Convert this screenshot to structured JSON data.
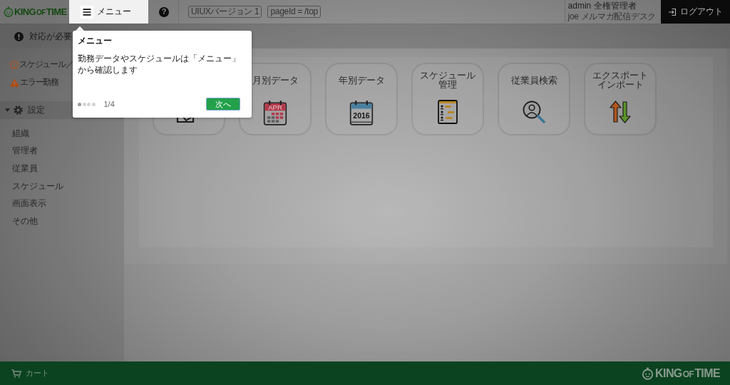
{
  "header": {
    "logo": {
      "words": [
        "KING",
        "OF",
        "TIME"
      ]
    },
    "menu_button": {
      "label": "メニュー"
    },
    "help": "?",
    "badges": [
      "UIUXバージョン 1",
      "pageId = /top"
    ],
    "user": {
      "account": "admin 全権管理者",
      "group": "joe メルマガ配信デスク"
    },
    "logout": "ログアウト"
  },
  "notice": {
    "text": "対応が必要"
  },
  "sidebar": {
    "alerts": [
      {
        "kind": "info",
        "label": "スケジュール／"
      },
      {
        "kind": "warning",
        "label": "エラー勤務"
      }
    ],
    "section": {
      "label": "設定",
      "expanded": true,
      "items": [
        "組織",
        "管理者",
        "従業員",
        "スケジュール",
        "画面表示",
        "その他"
      ]
    }
  },
  "tiles": [
    {
      "kind": "daily"
    },
    {
      "kind": "monthly",
      "label": "月別データ",
      "icon_text": "APR"
    },
    {
      "kind": "yearly",
      "label": "年別データ",
      "icon_text": "2016"
    },
    {
      "kind": "schedule",
      "label": "スケジュール管理"
    },
    {
      "kind": "search",
      "label": "従業員検索"
    },
    {
      "kind": "transfer",
      "label": "エクスポートインポート"
    }
  ],
  "footer": {
    "cart": "カート",
    "logo": {
      "words": [
        "KING",
        "OF",
        "TIME"
      ]
    }
  },
  "tour": {
    "title": "メニュー",
    "body": "勤務データやスケジュールは「メニュー」から確認します",
    "steps": [
      {
        "selected": true
      },
      {
        "selected": false
      },
      {
        "selected": false
      },
      {
        "selected": false
      }
    ],
    "counter": "1/4",
    "next": "次へ"
  }
}
